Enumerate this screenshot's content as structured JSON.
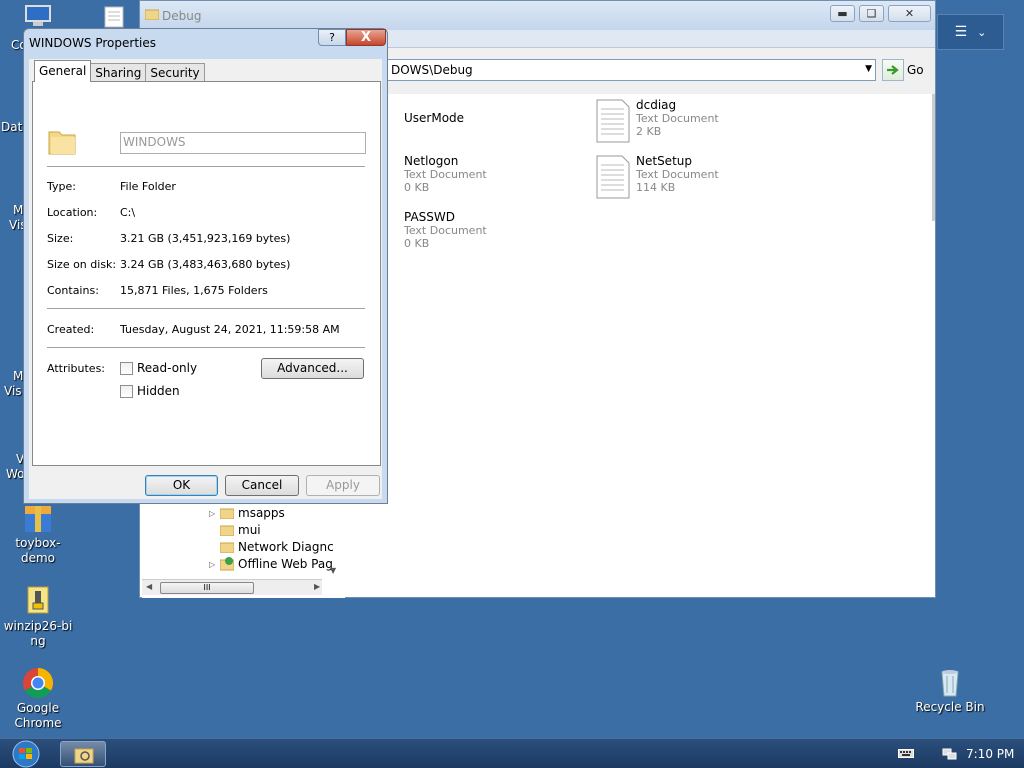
{
  "explorer": {
    "title": "Debug",
    "address": "DOWS\\Debug",
    "go_label": "Go",
    "files": [
      {
        "name": "UserMode",
        "type": "",
        "size": ""
      },
      {
        "name": "dcdiag",
        "type": "Text Document",
        "size": "2 KB"
      },
      {
        "name": "Netlogon",
        "type": "Text Document",
        "size": "0 KB"
      },
      {
        "name": "NetSetup",
        "type": "Text Document",
        "size": "114 KB"
      },
      {
        "name": "PASSWD",
        "type": "Text Document",
        "size": "0 KB"
      }
    ],
    "tree": [
      {
        "label": "msapps"
      },
      {
        "label": "mui"
      },
      {
        "label": "Network Diagnc"
      },
      {
        "label": "Offline Web Pag"
      }
    ],
    "scroll_grip": "III"
  },
  "dialog": {
    "title": "WINDOWS Properties",
    "help": "?",
    "close": "X",
    "tabs": [
      "General",
      "Sharing",
      "Security"
    ],
    "folder_name": "WINDOWS",
    "type_label": "Type:",
    "type_value": "File Folder",
    "location_label": "Location:",
    "location_value": "C:\\",
    "size_label": "Size:",
    "size_value": "3.21 GB (3,451,923,169 bytes)",
    "size_on_disk_label": "Size on disk:",
    "size_on_disk_value": "3.24 GB (3,483,463,680 bytes)",
    "contains_label": "Contains:",
    "contains_value": "15,871 Files, 1,675 Folders",
    "created_label": "Created:",
    "created_value": "Tuesday, August 24, 2021, 11:59:58 AM",
    "attributes_label": "Attributes:",
    "readonly_label": "Read-only",
    "hidden_label": "Hidden",
    "advanced_label": "Advanced...",
    "ok_label": "OK",
    "cancel_label": "Cancel",
    "apply_label": "Apply"
  },
  "desktop": {
    "icons": [
      {
        "label": "toybox-demo"
      },
      {
        "label": "winzip26-bing"
      },
      {
        "label": "Google Chrome"
      },
      {
        "label": "Recycle Bin"
      }
    ],
    "partial_labels": [
      "Co",
      "Data",
      "M",
      "Vis",
      "M",
      "Vis",
      "V",
      "Wo"
    ]
  },
  "taskbar": {
    "clock": "7:10 PM"
  },
  "colors": {
    "desktop_bg": "#3a6ea5",
    "taskbar_bg": "#1f416b"
  }
}
